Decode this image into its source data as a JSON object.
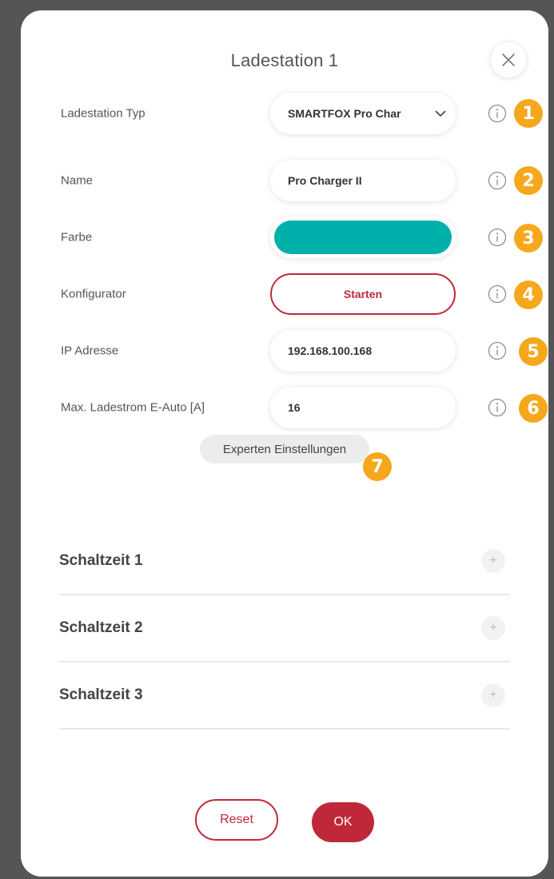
{
  "dialog": {
    "title": "Ladestation 1",
    "close_icon": "close-icon"
  },
  "fields": [
    {
      "label": "Ladestation Typ",
      "value": "SMARTFOX Pro Char",
      "kind": "select",
      "badge": "1"
    },
    {
      "label": "Name",
      "value": "Pro Charger II",
      "kind": "text",
      "badge": "2"
    },
    {
      "label": "Farbe",
      "value": "",
      "kind": "color",
      "color": "#00b0aa",
      "badge": "3"
    },
    {
      "label": "Konfigurator",
      "value": "Starten",
      "kind": "button",
      "badge": "4"
    },
    {
      "label": "IP Adresse",
      "value": "192.168.100.168",
      "kind": "text",
      "badge": "5"
    },
    {
      "label": "Max. Ladestrom E-Auto [A]",
      "value": "16",
      "kind": "text",
      "badge": "6"
    }
  ],
  "expert": {
    "label": "Experten Einstellungen",
    "badge": "7"
  },
  "schaltzeiten": [
    {
      "label": "Schaltzeit 1",
      "action": "+"
    },
    {
      "label": "Schaltzeit 2",
      "action": "+"
    },
    {
      "label": "Schaltzeit 3",
      "action": "+"
    }
  ],
  "footer": {
    "reset_label": "Reset",
    "ok_label": "OK"
  },
  "colors": {
    "accent": "#c0283a",
    "badge": "#f5a81c",
    "swatch": "#00b0aa"
  }
}
